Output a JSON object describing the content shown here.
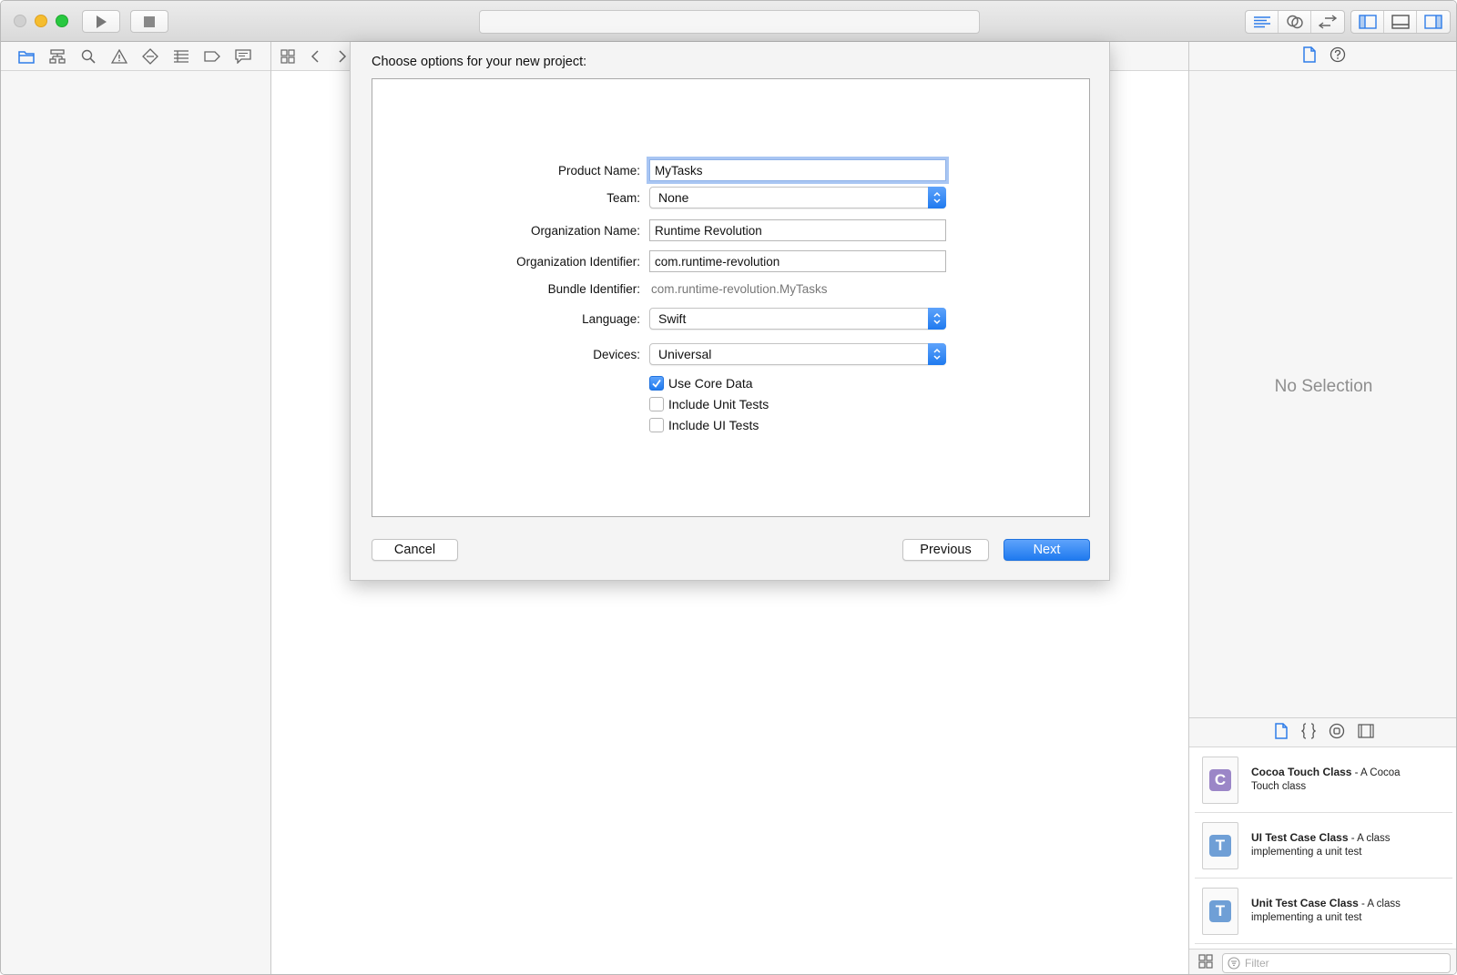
{
  "toolbar": {
    "run_icon": "play-icon",
    "stop_icon": "stop-icon",
    "activity_text": ""
  },
  "navigator": {
    "tabs": [
      "folder-icon",
      "hierarchy-icon",
      "search-icon",
      "warning-icon",
      "diamond-icon",
      "list-icon",
      "tag-icon",
      "comment-icon"
    ]
  },
  "sheet": {
    "title": "Choose options for your new project:",
    "product_name_label": "Product Name:",
    "product_name_value": "MyTasks",
    "team_label": "Team:",
    "team_value": "None",
    "org_name_label": "Organization Name:",
    "org_name_value": "Runtime Revolution",
    "org_id_label": "Organization Identifier:",
    "org_id_value": "com.runtime-revolution",
    "bundle_id_label": "Bundle Identifier:",
    "bundle_id_value": "com.runtime-revolution.MyTasks",
    "language_label": "Language:",
    "language_value": "Swift",
    "devices_label": "Devices:",
    "devices_value": "Universal",
    "checkboxes": [
      {
        "label": "Use Core Data",
        "checked": true
      },
      {
        "label": "Include Unit Tests",
        "checked": false
      },
      {
        "label": "Include UI Tests",
        "checked": false
      }
    ],
    "cancel_label": "Cancel",
    "previous_label": "Previous",
    "next_label": "Next"
  },
  "inspector": {
    "no_selection": "No Selection"
  },
  "library": {
    "items": [
      {
        "title": "Cocoa Touch Class",
        "desc_inline": " - A Cocoa",
        "desc_rest": "Touch class",
        "badge": "C",
        "badge_color": "#9b86c7"
      },
      {
        "title": "UI Test Case Class",
        "desc_inline": " - A class",
        "desc_rest": "implementing a unit test",
        "badge": "T",
        "badge_color": "#6f9fd6"
      },
      {
        "title": "Unit Test Case Class",
        "desc_inline": " - A class",
        "desc_rest": "implementing a unit test",
        "badge": "T",
        "badge_color": "#6f9fd6"
      }
    ],
    "filter_placeholder": "Filter"
  },
  "colors": {
    "accent": "#1f7aef",
    "toolbar_icon": "#4a8fe0"
  }
}
